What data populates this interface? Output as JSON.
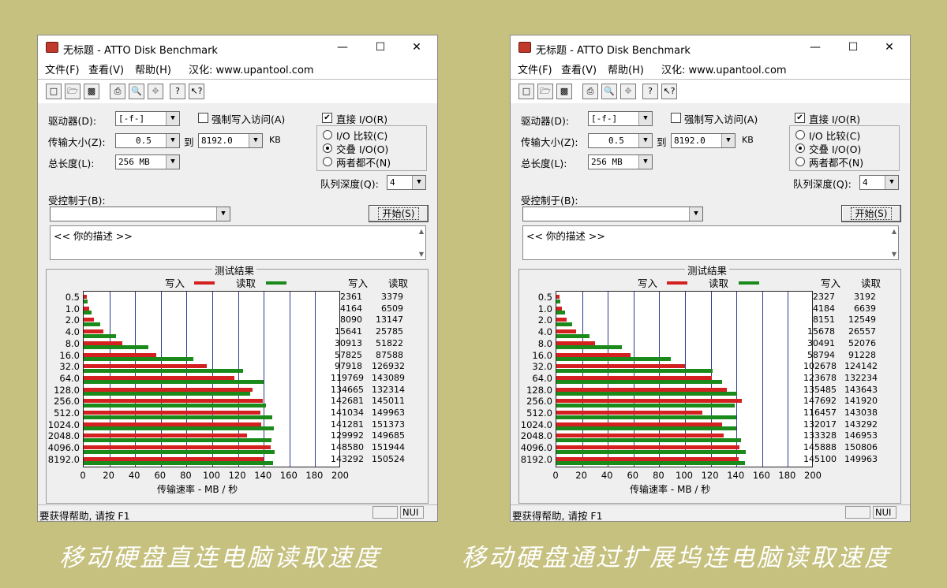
{
  "windows": [
    {
      "title": "无标题 - ATTO Disk Benchmark",
      "menu": [
        "文件(F)",
        "查看(V)",
        "帮助(H)",
        "汉化: www.upantool.com"
      ],
      "form": {
        "drive_label": "驱动器(D):",
        "drive_value": "[-f-]",
        "force_write_label": "强制写入访问(A)",
        "force_write_checked": false,
        "direct_io_label": "直接 I/O(R)",
        "direct_io_checked": true,
        "transfer_label": "传输大小(Z):",
        "transfer_from": "0.5",
        "to_label": "到",
        "transfer_to": "8192.0",
        "kb_label": "KB",
        "total_label": "总长度(L):",
        "total_value": "256 MB",
        "io_compare": "I/O 比较(C)",
        "overlap_io": "交叠 I/O(O)",
        "neither": "两者都不(N)",
        "selected_mode": "overlap",
        "queue_label": "队列深度(Q):",
        "queue_value": "4",
        "controlled_label": "受控制于(B):",
        "controlled_value": "",
        "start_button": "开始(S)",
        "description": "<<   你的描述   >>"
      },
      "results": {
        "title": "测试结果",
        "legend_write": "写入",
        "legend_read": "读取",
        "col_write": "写入",
        "col_read": "读取",
        "axis_title": "传输速率 - MB / 秒"
      },
      "status": {
        "text": "要获得帮助, 请按 F1",
        "num": "NUI"
      }
    },
    {
      "title": "无标题 - ATTO Disk Benchmark",
      "menu": [
        "文件(F)",
        "查看(V)",
        "帮助(H)",
        "汉化: www.upantool.com"
      ],
      "form": {
        "drive_label": "驱动器(D):",
        "drive_value": "[-f-]",
        "force_write_label": "强制写入访问(A)",
        "force_write_checked": false,
        "direct_io_label": "直接 I/O(R)",
        "direct_io_checked": true,
        "transfer_label": "传输大小(Z):",
        "transfer_from": "0.5",
        "to_label": "到",
        "transfer_to": "8192.0",
        "kb_label": "KB",
        "total_label": "总长度(L):",
        "total_value": "256 MB",
        "io_compare": "I/O 比较(C)",
        "overlap_io": "交叠 I/O(O)",
        "neither": "两者都不(N)",
        "selected_mode": "overlap",
        "queue_label": "队列深度(Q):",
        "queue_value": "4",
        "controlled_label": "受控制于(B):",
        "controlled_value": "",
        "start_button": "开始(S)",
        "description": "<<   你的描述   >>"
      },
      "results": {
        "title": "测试结果",
        "legend_write": "写入",
        "legend_read": "读取",
        "col_write": "写入",
        "col_read": "读取",
        "axis_title": "传输速率 - MB / 秒"
      },
      "status": {
        "text": "要获得帮助, 请按 F1",
        "num": "NUI"
      }
    }
  ],
  "chart_data": [
    {
      "type": "bar",
      "orientation": "horizontal",
      "categories": [
        "0.5",
        "1.0",
        "2.0",
        "4.0",
        "8.0",
        "16.0",
        "32.0",
        "64.0",
        "128.0",
        "256.0",
        "512.0",
        "1024.0",
        "2048.0",
        "4096.0",
        "8192.0"
      ],
      "series": [
        {
          "name": "写入",
          "color": "#d42020",
          "values_kbps": [
            2361,
            4164,
            8090,
            15641,
            30913,
            57825,
            97918,
            119769,
            134665,
            142681,
            141034,
            141281,
            129992,
            148580,
            143292
          ]
        },
        {
          "name": "读取",
          "color": "#1a8a1a",
          "values_kbps": [
            3379,
            6509,
            13147,
            25785,
            51822,
            87588,
            126932,
            143089,
            132314,
            145011,
            149963,
            151373,
            149685,
            151944,
            150524
          ]
        }
      ],
      "xlim": [
        0,
        200
      ],
      "xticks": [
        "0",
        "20",
        "40",
        "60",
        "80",
        "100",
        "120",
        "140",
        "160",
        "180",
        "200"
      ],
      "xlabel": "传输速率 - MB / 秒"
    },
    {
      "type": "bar",
      "orientation": "horizontal",
      "categories": [
        "0.5",
        "1.0",
        "2.0",
        "4.0",
        "8.0",
        "16.0",
        "32.0",
        "64.0",
        "128.0",
        "256.0",
        "512.0",
        "1024.0",
        "2048.0",
        "4096.0",
        "8192.0"
      ],
      "series": [
        {
          "name": "写入",
          "color": "#d42020",
          "values_kbps": [
            2327,
            4184,
            8151,
            15678,
            30491,
            58794,
            102678,
            123678,
            135485,
            147692,
            116457,
            132017,
            133328,
            145888,
            145100
          ]
        },
        {
          "name": "读取",
          "color": "#1a8a1a",
          "values_kbps": [
            3192,
            6639,
            12549,
            26557,
            52076,
            91228,
            124142,
            132234,
            143643,
            141920,
            143038,
            143292,
            146953,
            150806,
            149963
          ]
        }
      ],
      "xlim": [
        0,
        200
      ],
      "xticks": [
        "0",
        "20",
        "40",
        "60",
        "80",
        "100",
        "120",
        "140",
        "160",
        "180",
        "200"
      ],
      "xlabel": "传输速率 - MB / 秒"
    }
  ],
  "captions": [
    "移动硬盘直连电脑读取速度",
    "移动硬盘通过扩展坞连电脑读取速度"
  ]
}
